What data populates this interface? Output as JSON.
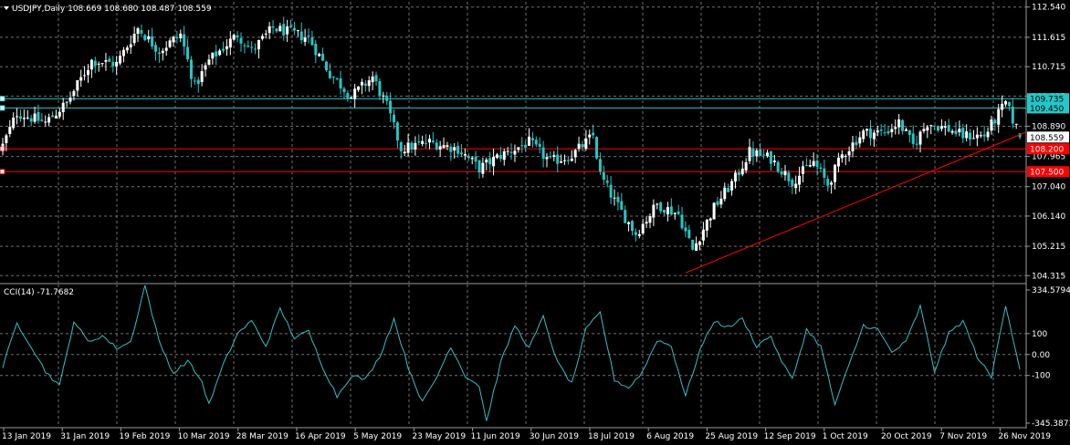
{
  "header": {
    "price_title": "USDJPY,Daily  108.669 108.680 108.487 108.559",
    "cci_title": "CCI(14) -71.7682"
  },
  "colors": {
    "background": "#000000",
    "grid": "#6f6f6f",
    "bull_candle": "#ffffff",
    "bear_candle": "#22c7c7",
    "cci_line": "#2fbfc8",
    "hline_cyan": "#22c7c7",
    "hline_red": "#ff0000",
    "trendline": "#ff0000",
    "axis_text": "#ffffff"
  },
  "chart_data": [
    {
      "type": "candlestick",
      "title": "USDJPY,Daily",
      "ohlc_last": {
        "open": 108.669,
        "high": 108.68,
        "low": 108.487,
        "close": 108.559
      },
      "ylim": [
        104.1,
        112.7
      ],
      "y_ticks": [
        "112.540",
        "111.615",
        "110.715",
        "109.815",
        "108.890",
        "107.965",
        "107.040",
        "106.140",
        "105.215",
        "104.315"
      ],
      "x_ticks": [
        "13 Jan 2019",
        "31 Jan 2019",
        "19 Feb 2019",
        "10 Mar 2019",
        "28 Mar 2019",
        "16 Apr 2019",
        "5 May 2019",
        "23 May 2019",
        "11 Jun 2019",
        "30 Jun 2019",
        "18 Jul 2019",
        "6 Aug 2019",
        "25 Aug 2019",
        "12 Sep 2019",
        "1 Oct 2019",
        "20 Oct 2019",
        "7 Nov 2019",
        "26 Nov 2019"
      ],
      "closes_anchors": [
        [
          0,
          108.3
        ],
        [
          4,
          109.3
        ],
        [
          12,
          109.0
        ],
        [
          18,
          109.6
        ],
        [
          25,
          110.9
        ],
        [
          32,
          110.8
        ],
        [
          38,
          111.9
        ],
        [
          44,
          111.2
        ],
        [
          50,
          111.7
        ],
        [
          54,
          110.1
        ],
        [
          58,
          110.9
        ],
        [
          66,
          111.7
        ],
        [
          70,
          111.2
        ],
        [
          76,
          111.9
        ],
        [
          86,
          111.6
        ],
        [
          92,
          110.5
        ],
        [
          98,
          109.8
        ],
        [
          104,
          110.4
        ],
        [
          108,
          109.5
        ],
        [
          112,
          108.2
        ],
        [
          120,
          108.4
        ],
        [
          128,
          108.2
        ],
        [
          134,
          107.6
        ],
        [
          140,
          108.0
        ],
        [
          148,
          108.4
        ],
        [
          154,
          107.8
        ],
        [
          160,
          108.0
        ],
        [
          166,
          108.6
        ],
        [
          168,
          107.4
        ],
        [
          172,
          106.6
        ],
        [
          178,
          105.6
        ],
        [
          184,
          106.5
        ],
        [
          190,
          106.2
        ],
        [
          194,
          105.1
        ],
        [
          200,
          106.4
        ],
        [
          206,
          107.3
        ],
        [
          210,
          108.1
        ],
        [
          216,
          107.9
        ],
        [
          222,
          107.2
        ],
        [
          228,
          107.8
        ],
        [
          232,
          107.1
        ],
        [
          236,
          108.0
        ],
        [
          242,
          108.7
        ],
        [
          248,
          108.7
        ],
        [
          252,
          109.0
        ],
        [
          256,
          108.3
        ],
        [
          260,
          109.0
        ],
        [
          266,
          108.8
        ],
        [
          270,
          108.6
        ],
        [
          276,
          108.6
        ],
        [
          282,
          109.6
        ],
        [
          286,
          108.6
        ]
      ],
      "horizontal_lines": [
        {
          "price": 109.735,
          "label": "109.735",
          "color": "#22c7c7"
        },
        {
          "price": 109.45,
          "label": "109.450",
          "color": "#22c7c7"
        },
        {
          "price": 108.2,
          "label": "108.200",
          "color": "#ff0000"
        },
        {
          "price": 107.5,
          "label": "107.500",
          "color": "#ff0000"
        }
      ],
      "current_price": {
        "price": 108.559,
        "label": "108.559"
      },
      "trendline": {
        "start": [
          192,
          104.4
        ],
        "end": [
          286,
          108.7
        ]
      }
    },
    {
      "type": "line",
      "title": "CCI(14) -71.7682",
      "ylim": [
        -345.3873,
        334.5794
      ],
      "y_ticks": [
        "334.5794",
        "100",
        "0.00",
        "-100",
        "-345.3873"
      ],
      "levels": [
        100,
        0,
        -100
      ],
      "anchors": [
        [
          0,
          -60
        ],
        [
          4,
          150
        ],
        [
          8,
          40
        ],
        [
          12,
          -80
        ],
        [
          16,
          -150
        ],
        [
          20,
          160
        ],
        [
          24,
          60
        ],
        [
          28,
          90
        ],
        [
          32,
          30
        ],
        [
          36,
          60
        ],
        [
          40,
          330
        ],
        [
          44,
          60
        ],
        [
          48,
          -90
        ],
        [
          52,
          -30
        ],
        [
          56,
          -130
        ],
        [
          58,
          -240
        ],
        [
          62,
          -50
        ],
        [
          66,
          100
        ],
        [
          70,
          160
        ],
        [
          74,
          40
        ],
        [
          78,
          220
        ],
        [
          82,
          80
        ],
        [
          86,
          110
        ],
        [
          90,
          -60
        ],
        [
          94,
          -200
        ],
        [
          98,
          -100
        ],
        [
          102,
          -120
        ],
        [
          106,
          -10
        ],
        [
          110,
          170
        ],
        [
          114,
          -60
        ],
        [
          118,
          -230
        ],
        [
          122,
          -110
        ],
        [
          126,
          40
        ],
        [
          130,
          -100
        ],
        [
          134,
          -150
        ],
        [
          136,
          -320
        ],
        [
          140,
          -40
        ],
        [
          144,
          140
        ],
        [
          148,
          30
        ],
        [
          152,
          180
        ],
        [
          156,
          -40
        ],
        [
          160,
          -140
        ],
        [
          164,
          120
        ],
        [
          168,
          200
        ],
        [
          172,
          -120
        ],
        [
          176,
          -160
        ],
        [
          180,
          -80
        ],
        [
          184,
          70
        ],
        [
          188,
          40
        ],
        [
          192,
          -200
        ],
        [
          196,
          20
        ],
        [
          200,
          160
        ],
        [
          204,
          130
        ],
        [
          208,
          170
        ],
        [
          212,
          40
        ],
        [
          216,
          90
        ],
        [
          218,
          0
        ],
        [
          222,
          -120
        ],
        [
          226,
          120
        ],
        [
          230,
          40
        ],
        [
          234,
          -240
        ],
        [
          238,
          -50
        ],
        [
          242,
          140
        ],
        [
          246,
          120
        ],
        [
          250,
          10
        ],
        [
          254,
          60
        ],
        [
          258,
          230
        ],
        [
          262,
          -80
        ],
        [
          266,
          100
        ],
        [
          270,
          160
        ],
        [
          274,
          -10
        ],
        [
          278,
          -110
        ],
        [
          282,
          240
        ],
        [
          286,
          -72
        ]
      ]
    }
  ]
}
